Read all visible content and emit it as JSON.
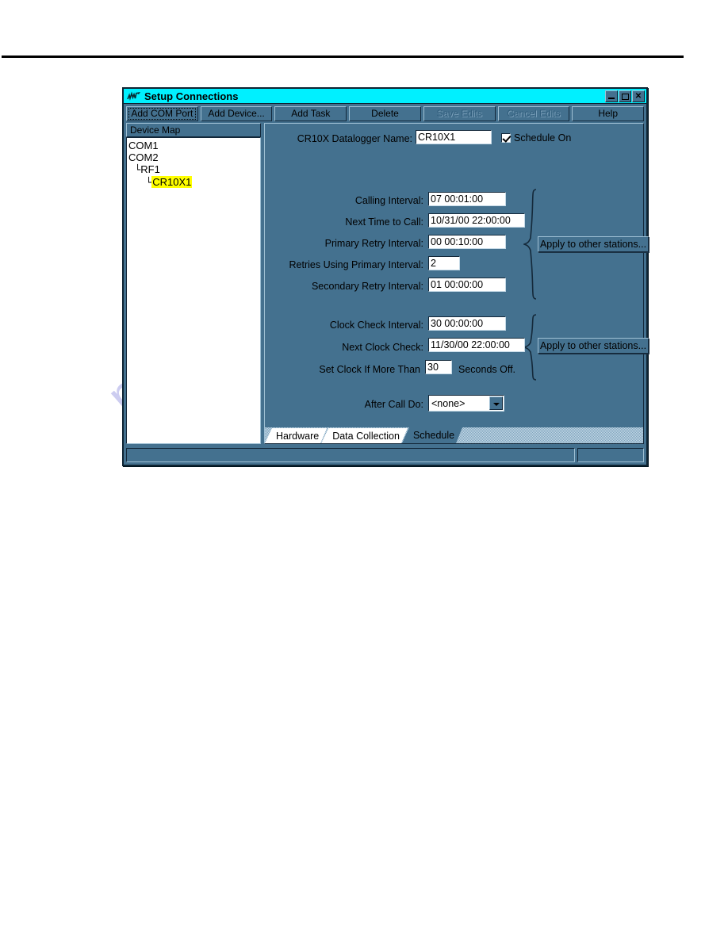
{
  "page": {
    "watermark": "manualslib.com"
  },
  "window": {
    "title": "Setup Connections",
    "icon": "antenna-waveform-icon",
    "controls": {
      "minimize": "minimize-icon",
      "maximize": "maximize-icon",
      "close": "✕"
    }
  },
  "toolbar": {
    "buttons": [
      {
        "label": "Add COM Port",
        "accel": "C",
        "state": "focused"
      },
      {
        "label": "Add Device...",
        "accel": "A",
        "state": "enabled"
      },
      {
        "label": "Add Task",
        "accel": "T",
        "state": "enabled"
      },
      {
        "label": "Delete",
        "accel": "D",
        "state": "enabled"
      },
      {
        "label": "Save Edits",
        "accel": "S",
        "state": "disabled"
      },
      {
        "label": "Cancel Edits",
        "accel": "n",
        "state": "disabled"
      },
      {
        "label": "Help",
        "accel": "H",
        "state": "enabled"
      }
    ]
  },
  "device_map": {
    "header": "Device Map",
    "nodes": [
      {
        "label": "COM1",
        "depth": 0,
        "selected": false
      },
      {
        "label": "COM2",
        "depth": 0,
        "selected": false
      },
      {
        "label": "RF1",
        "depth": 1,
        "selected": false
      },
      {
        "label": "CR10X1",
        "depth": 2,
        "selected": true
      }
    ]
  },
  "schedule_tab": {
    "datalogger_name_label": "CR10X Datalogger Name:",
    "datalogger_name_value": "CR10X1",
    "schedule_on_label": "Schedule On",
    "schedule_on_checked": true,
    "call_group": {
      "fields": [
        {
          "label": "Calling Interval:",
          "value": "07 00:01:00"
        },
        {
          "label": "Next Time to Call:",
          "value": "10/31/00 22:00:00"
        },
        {
          "label": "Primary Retry Interval:",
          "value": "00 00:10:00"
        },
        {
          "label": "Retries Using Primary Interval:",
          "value": "2"
        },
        {
          "label": "Secondary Retry Interval:",
          "value": "01 00:00:00"
        }
      ],
      "apply_button": "Apply to other stations..."
    },
    "clock_group": {
      "fields": [
        {
          "label": "Clock Check Interval:",
          "value": "30 00:00:00"
        },
        {
          "label": "Next Clock Check:",
          "value": "11/30/00 22:00:00"
        },
        {
          "label": "Set Clock If More Than",
          "value": "30",
          "suffix": "Seconds Off."
        }
      ],
      "apply_button": "Apply to other stations..."
    },
    "after_call": {
      "label": "After Call Do:",
      "value": "<none>"
    }
  },
  "tabs": [
    {
      "label": "Hardware",
      "accel": "w",
      "active": false
    },
    {
      "label": "Data Collection",
      "accel": "C",
      "active": false
    },
    {
      "label": "Schedule",
      "accel": "d",
      "active": true
    }
  ],
  "statusbar": {
    "main": "",
    "side": ""
  },
  "colors": {
    "titlebar": "#00f0ff",
    "dialog_face": "#44718f",
    "field_bg": "#ffffff",
    "selection": "#ffff00",
    "watermark": "#ccccf0"
  }
}
